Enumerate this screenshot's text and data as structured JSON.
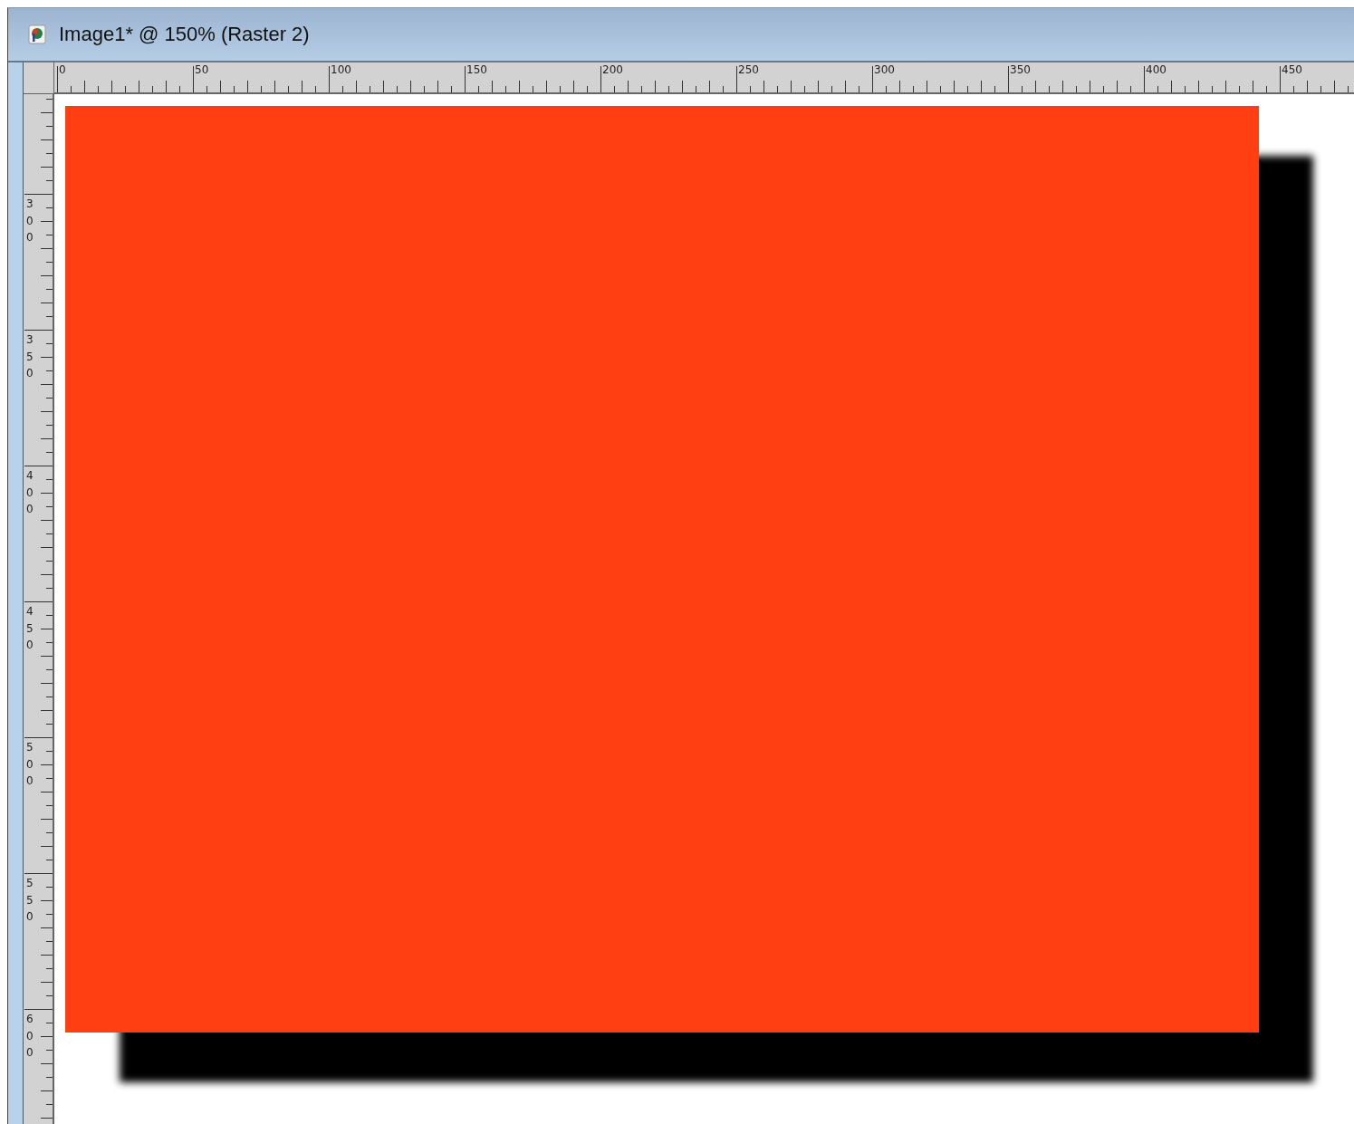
{
  "window": {
    "title": "Image1* @ 150% (Raster 2)"
  },
  "horizontal_ruler": {
    "labels": [
      "0",
      "50",
      "100",
      "150",
      "200",
      "250",
      "300",
      "350",
      "400",
      "450"
    ]
  },
  "vertical_ruler": {
    "labels": [
      "300",
      "350",
      "400",
      "450",
      "500",
      "550",
      "600"
    ]
  }
}
